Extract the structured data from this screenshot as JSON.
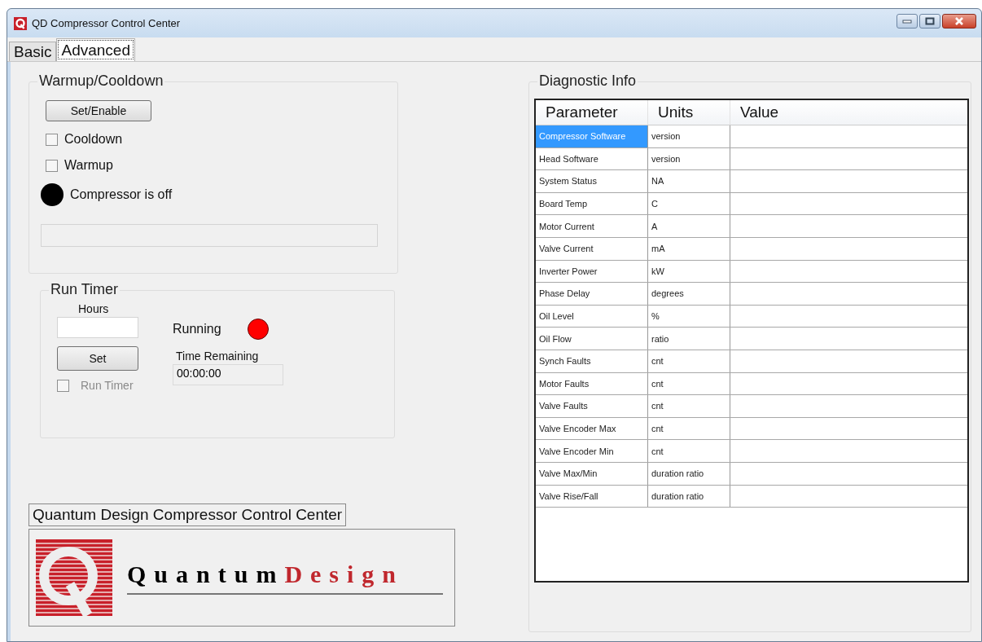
{
  "window": {
    "title": "QD Compressor Control Center"
  },
  "tabs": [
    {
      "label": "Basic",
      "selected": false
    },
    {
      "label": "Advanced",
      "selected": true
    }
  ],
  "warmup": {
    "title": "Warmup/Cooldown",
    "button": "Set/Enable",
    "checkboxes": [
      {
        "label": "Cooldown",
        "checked": false,
        "disabled": false
      },
      {
        "label": "Warmup",
        "checked": false,
        "disabled": false
      }
    ],
    "status": {
      "label": "Compressor is off",
      "color": "#000000"
    }
  },
  "run_timer": {
    "title": "Run Timer",
    "hours_label": "Hours",
    "button": "Set",
    "checkbox": {
      "label": "Run Timer",
      "checked": false,
      "disabled": true
    },
    "running": {
      "label": "Running",
      "color": "#ff0000"
    },
    "remaining_label": "Time Remaining",
    "remaining_value": "00:00:00"
  },
  "caption": "Quantum Design Compressor Control Center",
  "logo": {
    "word_1": "Quantum",
    "word_2": "Design"
  },
  "diagnostics": {
    "title": "Diagnostic Info",
    "columns": [
      "Parameter",
      "Units",
      "Value"
    ],
    "rows": [
      {
        "parameter": "Compressor Software",
        "units": "version",
        "selected": true
      },
      {
        "parameter": "Head Software",
        "units": "version",
        "selected": false
      },
      {
        "parameter": "System Status",
        "units": "NA",
        "selected": false
      },
      {
        "parameter": "Board Temp",
        "units": "C",
        "selected": false
      },
      {
        "parameter": "Motor Current",
        "units": "A",
        "selected": false
      },
      {
        "parameter": "Valve Current",
        "units": "mA",
        "selected": false
      },
      {
        "parameter": "Inverter Power",
        "units": "kW",
        "selected": false
      },
      {
        "parameter": "Phase Delay",
        "units": "degrees",
        "selected": false
      },
      {
        "parameter": "Oil Level",
        "units": "%",
        "selected": false
      },
      {
        "parameter": "Oil Flow",
        "units": "ratio",
        "selected": false
      },
      {
        "parameter": "Synch Faults",
        "units": "cnt",
        "selected": false
      },
      {
        "parameter": "Motor Faults",
        "units": "cnt",
        "selected": false
      },
      {
        "parameter": "Valve Faults",
        "units": "cnt",
        "selected": false
      },
      {
        "parameter": "Valve Encoder Max",
        "units": "cnt",
        "selected": false
      },
      {
        "parameter": "Valve Encoder Min",
        "units": "cnt",
        "selected": false
      },
      {
        "parameter": "Valve Max/Min",
        "units": "duration ratio",
        "selected": false
      },
      {
        "parameter": "Valve Rise/Fall",
        "units": "duration ratio",
        "selected": false
      }
    ]
  }
}
